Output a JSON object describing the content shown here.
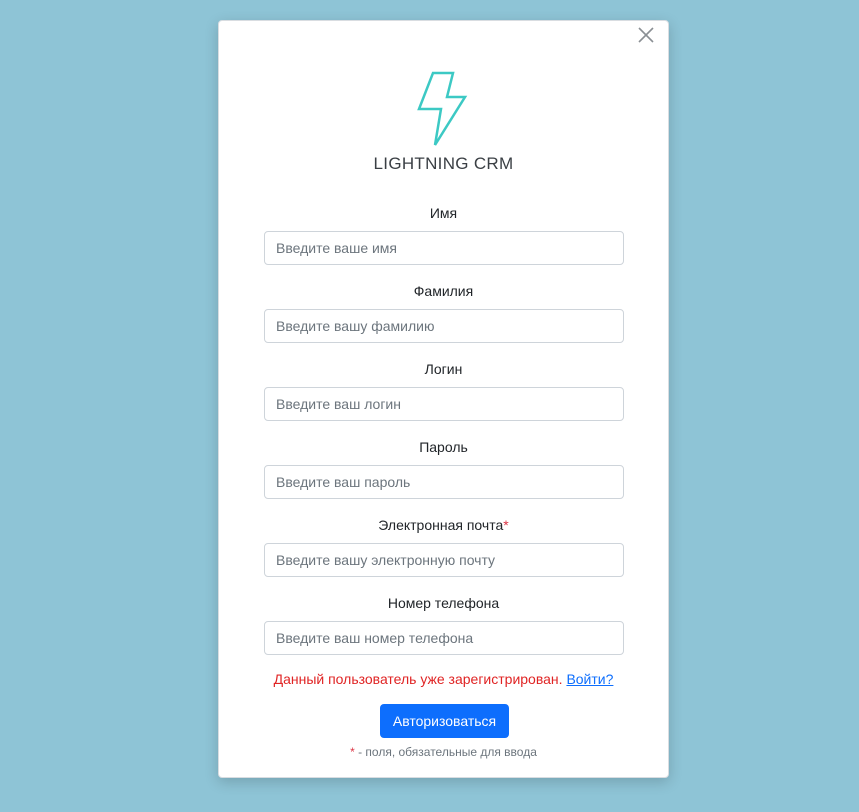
{
  "colors": {
    "background": "#8ec4d6",
    "logo_stroke": "#3cc9c4",
    "primary": "#0d6efd",
    "error": "#e02424",
    "required": "#dc3545"
  },
  "modal": {
    "close_icon": "close-icon",
    "logo_icon": "lightning-bolt-icon",
    "brand": "LIGHTNING CRM"
  },
  "form": {
    "fields": [
      {
        "label": "Имя",
        "placeholder": "Введите ваше имя",
        "value": "",
        "required": false
      },
      {
        "label": "Фамилия",
        "placeholder": "Введите вашу фамилию",
        "value": "",
        "required": false
      },
      {
        "label": "Логин",
        "placeholder": "Введите ваш логин",
        "value": "",
        "required": false
      },
      {
        "label": "Пароль",
        "placeholder": "Введите ваш пароль",
        "value": "",
        "required": false
      },
      {
        "label": "Электронная почта",
        "placeholder": "Введите вашу электронную почту",
        "value": "",
        "required": true
      },
      {
        "label": "Номер телефона",
        "placeholder": "Введите ваш номер телефона",
        "value": "",
        "required": false
      }
    ],
    "required_mark": "*",
    "error_text": "Данный пользователь уже зарегистрирован. ",
    "error_link": "Войти?",
    "submit_label": "Авторизоваться",
    "footnote_mark": "*",
    "footnote_text": " - поля, обязательные для ввода"
  }
}
